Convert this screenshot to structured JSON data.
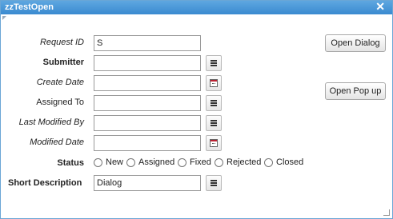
{
  "window": {
    "title": "zzTestOpen"
  },
  "fields": [
    {
      "label": "Request ID",
      "style": "italic",
      "value": "S",
      "button": "none"
    },
    {
      "label": "Submitter",
      "style": "bold",
      "value": "",
      "button": "menu"
    },
    {
      "label": "Create Date",
      "style": "italic",
      "value": "",
      "button": "calendar"
    },
    {
      "label": "Assigned To",
      "style": "normal",
      "value": "",
      "button": "menu"
    },
    {
      "label": "Last Modified By",
      "style": "italic",
      "value": "",
      "button": "menu"
    },
    {
      "label": "Modified Date",
      "style": "italic",
      "value": "",
      "button": "calendar"
    }
  ],
  "status": {
    "label": "Status",
    "options": [
      "New",
      "Assigned",
      "Fixed",
      "Rejected",
      "Closed"
    ]
  },
  "short_description": {
    "label": "Short Description",
    "value": "Dialog"
  },
  "buttons": {
    "open_dialog": "Open Dialog",
    "open_popup": "Open Pop up"
  },
  "icons": {
    "close": "close-icon",
    "menu": "menu-icon",
    "calendar": "calendar-icon"
  },
  "colors": {
    "titlebar": "#3a8ad0",
    "border": "#6aa6d6"
  }
}
